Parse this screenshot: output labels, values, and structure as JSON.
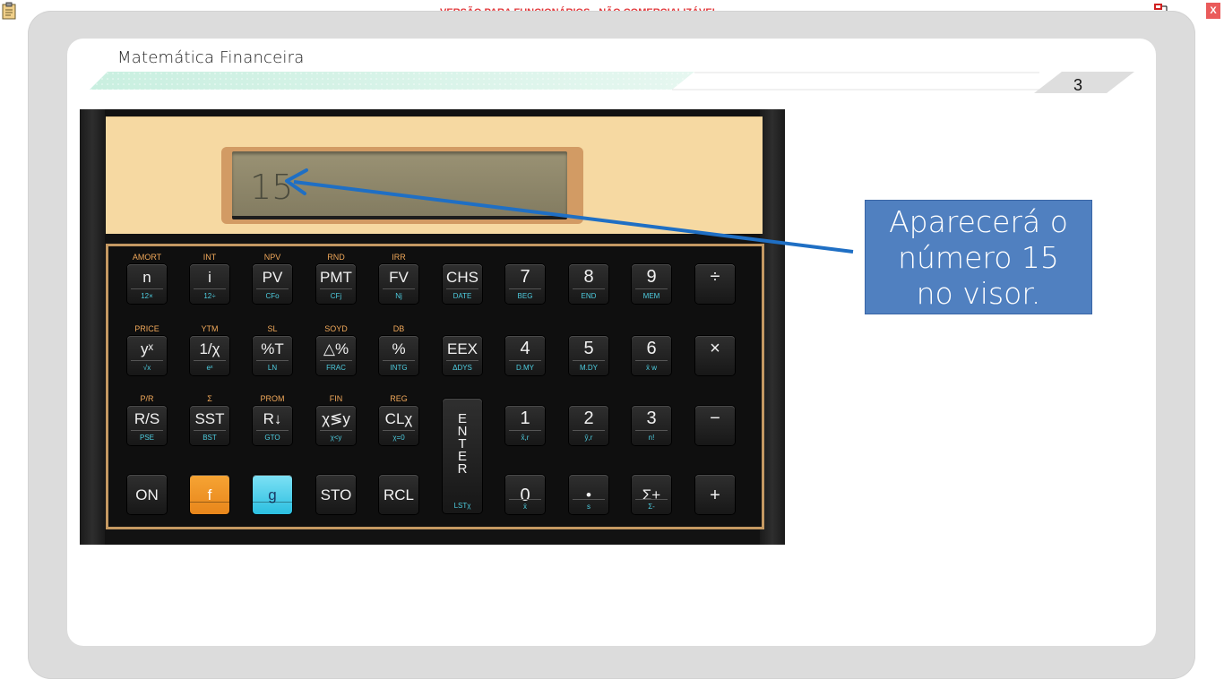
{
  "topbar": {
    "banner": "VERSÃO PARA FUNCIONÁRIOS - NÃO COMERCIALIZÁVEL",
    "close_label": "X",
    "clipboard_icon": "clipboard-icon",
    "network_icon": "network-icon",
    "banner_color": "#e2383b"
  },
  "slide": {
    "title": "Matemática Financeira",
    "page_number": "3"
  },
  "calculator": {
    "display_value": "15",
    "enter_label": "E\nN\nT\nE\nR",
    "enter_sub": "LSTχ",
    "rows": [
      [
        {
          "top": "AMORT",
          "main": "n",
          "sub": "12×"
        },
        {
          "top": "INT",
          "main": "i",
          "sub": "12÷"
        },
        {
          "top": "NPV",
          "main": "PV",
          "sub": "CFo"
        },
        {
          "top": "RND",
          "main": "PMT",
          "sub": "CFj"
        },
        {
          "top": "IRR",
          "main": "FV",
          "sub": "Nj"
        },
        {
          "top": "",
          "main": "CHS",
          "sub": "DATE"
        },
        {
          "top": "",
          "main": "7",
          "sub": "BEG"
        },
        {
          "top": "",
          "main": "8",
          "sub": "END"
        },
        {
          "top": "",
          "main": "9",
          "sub": "MEM"
        },
        {
          "top": "",
          "main": "÷",
          "sub": ""
        }
      ],
      [
        {
          "top": "PRICE",
          "main": "yˣ",
          "sub": "√x"
        },
        {
          "top": "YTM",
          "main": "1/χ",
          "sub": "eˣ"
        },
        {
          "top": "SL",
          "main": "%T",
          "sub": "LN"
        },
        {
          "top": "SOYD",
          "main": "△%",
          "sub": "FRAC"
        },
        {
          "top": "DB",
          "main": "%",
          "sub": "INTG"
        },
        {
          "top": "",
          "main": "EEX",
          "sub": "ΔDYS"
        },
        {
          "top": "",
          "main": "4",
          "sub": "D.MY"
        },
        {
          "top": "",
          "main": "5",
          "sub": "M.DY"
        },
        {
          "top": "",
          "main": "6",
          "sub": "x̄ w"
        },
        {
          "top": "",
          "main": "×",
          "sub": ""
        }
      ],
      [
        {
          "top": "P/R",
          "main": "R/S",
          "sub": "PSE"
        },
        {
          "top": "Σ",
          "main": "SST",
          "sub": "BST"
        },
        {
          "top": "PROM",
          "main": "R↓",
          "sub": "GTO"
        },
        {
          "top": "FIN",
          "main": "χ≶y",
          "sub": "χ<y"
        },
        {
          "top": "REG",
          "main": "CLχ",
          "sub": "χ=0"
        },
        {
          "top": "",
          "main": "",
          "sub": ""
        },
        {
          "top": "",
          "main": "1",
          "sub": "x̂,r"
        },
        {
          "top": "",
          "main": "2",
          "sub": "ŷ,r"
        },
        {
          "top": "",
          "main": "3",
          "sub": "n!"
        },
        {
          "top": "",
          "main": "−",
          "sub": ""
        }
      ],
      [
        {
          "top": "",
          "main": "ON",
          "sub": ""
        },
        {
          "top": "",
          "main": "f",
          "sub": ""
        },
        {
          "top": "",
          "main": "g",
          "sub": ""
        },
        {
          "top": "",
          "main": "STO",
          "sub": ""
        },
        {
          "top": "",
          "main": "RCL",
          "sub": ""
        },
        {
          "top": "",
          "main": "",
          "sub": ""
        },
        {
          "top": "",
          "main": "0",
          "sub": "x̄"
        },
        {
          "top": "",
          "main": "•",
          "sub": "s"
        },
        {
          "top": "",
          "main": "Σ+",
          "sub": "Σ-"
        },
        {
          "top": "",
          "main": "+",
          "sub": ""
        }
      ]
    ],
    "accent_f": "#f09a2a",
    "accent_g": "#3cc8e8"
  },
  "callout": {
    "line1": "Aparecerá o",
    "line2": "número 15",
    "line3": "no visor.",
    "color": "#5080c0"
  }
}
